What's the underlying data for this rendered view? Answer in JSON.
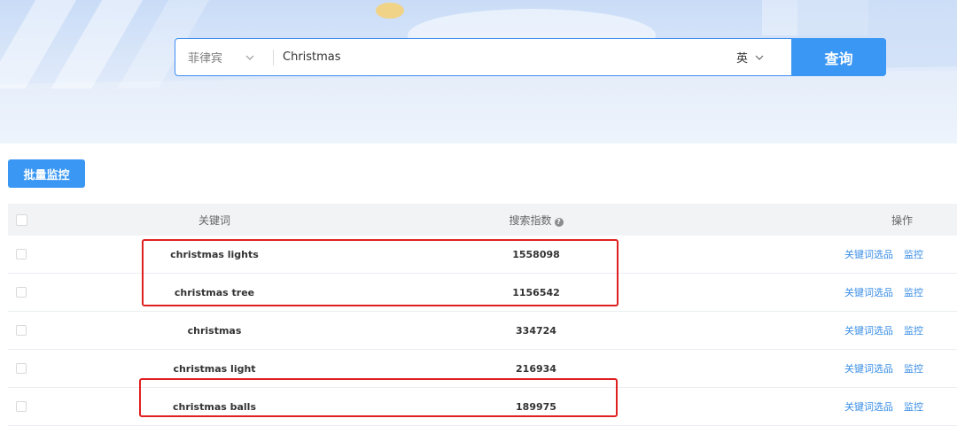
{
  "search": {
    "region": "菲律宾",
    "query": "Christmas",
    "language": "英",
    "submit_label": "查询"
  },
  "toolbar": {
    "batch_monitor_label": "批量监控"
  },
  "table": {
    "columns": {
      "keyword": "关键词",
      "search_index": "搜索指数",
      "actions": "操作"
    },
    "rows": [
      {
        "keyword": "christmas lights",
        "index": "1558098",
        "action_select": "关键词选品",
        "action_monitor": "监控"
      },
      {
        "keyword": "christmas tree",
        "index": "1156542",
        "action_select": "关键词选品",
        "action_monitor": "监控"
      },
      {
        "keyword": "christmas",
        "index": "334724",
        "action_select": "关键词选品",
        "action_monitor": "监控"
      },
      {
        "keyword": "christmas light",
        "index": "216934",
        "action_select": "关键词选品",
        "action_monitor": "监控"
      },
      {
        "keyword": "christmas balls",
        "index": "189975",
        "action_select": "关键词选品",
        "action_monitor": "监控"
      }
    ]
  },
  "colors": {
    "accent": "#3a97f4",
    "link": "#3a8ee6",
    "highlight": "#e02020"
  }
}
